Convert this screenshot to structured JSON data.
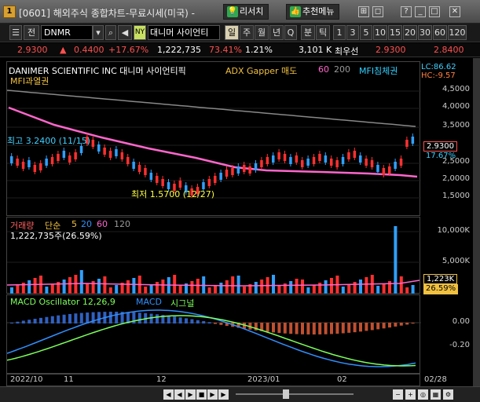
{
  "window": {
    "app_icon": "1",
    "title": "[0601] 해외주식 종합차트-무료시세(미국) - ",
    "research_label": "리서치",
    "recommend_label": "추천메뉴",
    "buttons": [
      "⊞",
      "◻",
      "?",
      "_",
      "□",
      "✕"
    ]
  },
  "toolbar": {
    "market_label": "전",
    "symbol_value": "DNMR",
    "exchange_badge": "NY",
    "stock_name": "대니머 사이언티",
    "periods": [
      "일",
      "주",
      "월",
      "년",
      "Q",
      "분",
      "틱"
    ],
    "intervals": [
      "1",
      "3",
      "5",
      "10",
      "15",
      "20",
      "30",
      "60",
      "120"
    ]
  },
  "quote": {
    "price": "2.9300",
    "change": "0.4400",
    "change_pct": "+17.67%",
    "volume": "1,222,735",
    "vol_ratio": "73.41%",
    "turnover": "1.21%",
    "amount": "3,101 K",
    "best_label": "최우선",
    "ask": "2.9300",
    "bid": "2.8400"
  },
  "price_panel": {
    "title": "DANIMER SCIENTIFIC INC 대니머 사이언티픽",
    "indicator1": "ADX Gapper 매도",
    "ma1": "60",
    "ma2": "200",
    "mfi_sell": "MFI침체권",
    "mfi_overbought": "MFI과열권",
    "lc_label": "LC:86.62",
    "hc_label": "HC:-9.57",
    "high_note": "최고 3.2400 (11/15)",
    "low_note": "최저 1.5700 (12/27)",
    "current_tag": "2.9300",
    "current_pct": "17.67%",
    "ticks": [
      "4,5000",
      "4,0000",
      "3,5000",
      "3,0000",
      "2,5000",
      "2,0000",
      "1,5000"
    ]
  },
  "volume_panel": {
    "title": "거래량",
    "ma_label": "단순",
    "ma_values": [
      "5",
      "20",
      "60",
      "120"
    ],
    "volume_text": "1,222,735주(26.59%)",
    "ticks": [
      "10,000K",
      "5,000K"
    ],
    "current_tag": "1,223K",
    "pct_tag": "26.59%"
  },
  "macd_panel": {
    "title": "MACD Oscillator 12,26,9",
    "macd_label": "MACD",
    "signal_label": "시그널",
    "ticks": [
      "0.00",
      "-0.20"
    ]
  },
  "xaxis": {
    "labels": [
      "2022/10",
      "11",
      "12",
      "2023/01",
      "02",
      "02/28"
    ]
  },
  "colors": {
    "up": "#ff3030",
    "down": "#30a0ff",
    "ma60": "#ff66cc",
    "ma200": "#888888",
    "macd": "#3090ff",
    "signal": "#7cff5a"
  }
}
